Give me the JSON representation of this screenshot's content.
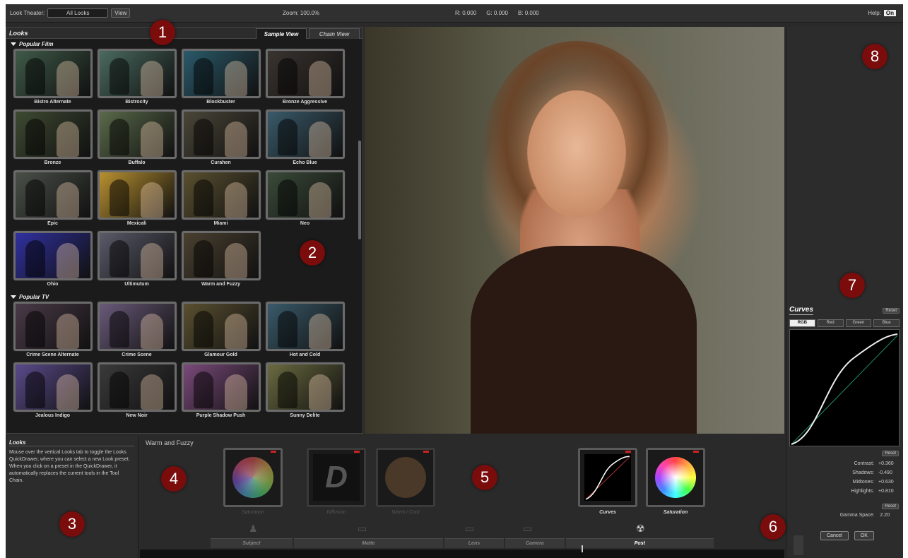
{
  "topbar": {
    "look_theater_label": "Look Theater:",
    "look_theater_value": "All Looks",
    "view_button": "View",
    "zoom": "Zoom: 100.0%",
    "r": "R: 0.000",
    "g": "G: 0.000",
    "b": "B: 0.000",
    "help_label": "Help:",
    "help_value": "On"
  },
  "looks_panel": {
    "title": "Looks",
    "tabs": [
      "Sample View",
      "Chain View"
    ],
    "sections": [
      {
        "title": "Popular Film",
        "items": [
          "Bistro Alternate",
          "Bistrocity",
          "Blockbuster",
          "Bronze Aggressive",
          "Bronze",
          "Buffalo",
          "Curahen",
          "Echo Blue",
          "Epic",
          "Mexicali",
          "Miami",
          "Neo",
          "Ohio",
          "Ultimutum",
          "Warm and Fuzzy"
        ]
      },
      {
        "title": "Popular TV",
        "items": [
          "Crime Scene Alternate",
          "Crime Scene",
          "Glamour Gold",
          "Hot and Cold",
          "Jealous Indigo",
          "New Noir",
          "Purple Shadow Push",
          "Sunny Delite"
        ]
      }
    ],
    "thumb_tints": {
      "Bistro Alternate": "#3f5a48",
      "Bistrocity": "#4a6a60",
      "Blockbuster": "#2a5a6a",
      "Bronze Aggressive": "#3a3430",
      "Bronze": "#3e4a32",
      "Buffalo": "#5a6a4a",
      "Curahen": "#4a4638",
      "Echo Blue": "#3a5a6a",
      "Epic": "#4a5048",
      "Mexicali": "#b89030",
      "Miami": "#5a5030",
      "Neo": "#3a4a38",
      "Ohio": "#3030a0",
      "Ultimutum": "#5a5a6a",
      "Warm and Fuzzy": "#4a4030",
      "Crime Scene Alternate": "#4a3a48",
      "Crime Scene": "#6a5a7a",
      "Glamour Gold": "#5a5030",
      "Hot and Cold": "#3a5a6a",
      "Jealous Indigo": "#5a4a8a",
      "New Noir": "#3a3a3a",
      "Purple Shadow Push": "#7a4a7a",
      "Sunny Delite": "#6a6a40"
    }
  },
  "description": {
    "title": "Looks",
    "body": "Mouse over the vertical Looks tab to toggle the Looks QuickDrawer, where you can select a new Look preset. When you click on a preset in the QuickDrawer, it automatically replaces the current tools in the Tool Chain."
  },
  "tools": {
    "look_name": "Warm and Fuzzy",
    "slots": [
      {
        "label": "Saturation",
        "active": false
      },
      {
        "label": "Diffusion",
        "active": false
      },
      {
        "label": "Warm / Cool",
        "active": false
      },
      {
        "label": "Curves",
        "active": true
      },
      {
        "label": "Saturation",
        "active": true
      }
    ],
    "categories": [
      "Subject",
      "Matte",
      "Lens",
      "Camera",
      "Post"
    ],
    "active_category": "Post"
  },
  "curves_panel": {
    "title": "Curves",
    "reset": "Reset",
    "channels": [
      "RGB",
      "Red",
      "Green",
      "Blue"
    ],
    "active_channel": "RGB",
    "params": [
      {
        "label": "Contrast:",
        "value": "+0.360"
      },
      {
        "label": "Shadows:",
        "value": "-0.490"
      },
      {
        "label": "Midtones:",
        "value": "+0.630"
      },
      {
        "label": "Highlights:",
        "value": "+0.810"
      }
    ],
    "gamma_label": "Gamma Space:",
    "gamma_value": "2.20",
    "cancel": "Cancel",
    "ok": "OK"
  },
  "badges": [
    "1",
    "2",
    "3",
    "4",
    "5",
    "6",
    "7",
    "8"
  ]
}
